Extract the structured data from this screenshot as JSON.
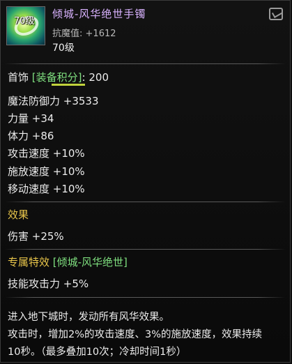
{
  "item": {
    "name": "倾城-风华绝世手镯",
    "level_badge": "70级",
    "resist_label": "抗魔值:",
    "resist_value": "+1612",
    "level": "70级"
  },
  "icons": {
    "item_icon": "bracelet-icon",
    "corner_icon": "trade-lock-icon"
  },
  "slot": {
    "type": "首饰",
    "score_label": "[装备积分]",
    "score_sep": ":",
    "score_value": "200"
  },
  "stats": [
    "魔法防御力 +3533",
    "力量 +34",
    "体力 +86",
    "攻击速度 +10%",
    "施放速度 +10%",
    "移动速度 +10%"
  ],
  "effect": {
    "title": "效果",
    "lines": [
      "伤害 +25%"
    ]
  },
  "exclusive": {
    "title": "专属特效",
    "set_name": "[倾城-风华绝世]",
    "line": "技能攻击力 +5%"
  },
  "description": [
    "进入地下城时，发动所有风华效果。",
    "攻击时，增加2%的攻击速度、3%的施放速度，效果持续",
    "10秒。（最多叠加10次；冷却时间1秒）"
  ],
  "colors": {
    "name": "#d9b3ff",
    "gold": "#e8c54a",
    "green": "#7fe07f"
  }
}
